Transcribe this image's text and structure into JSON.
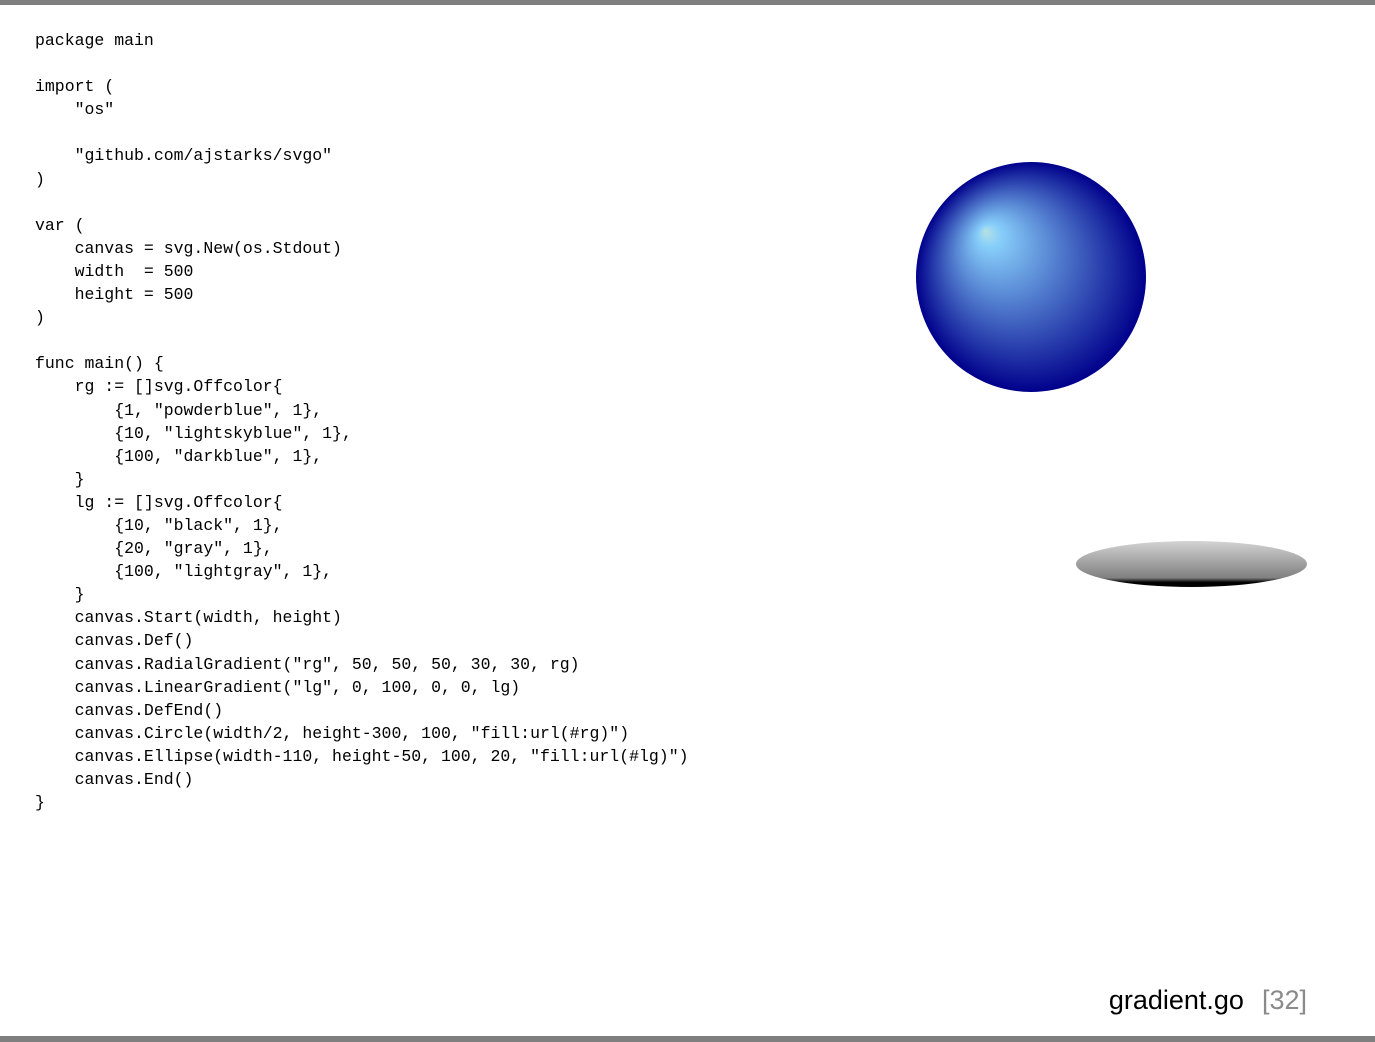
{
  "code": {
    "lines": [
      "package main",
      "",
      "import (",
      "    \"os\"",
      "",
      "    \"github.com/ajstarks/svgo\"",
      ")",
      "",
      "var (",
      "    canvas = svg.New(os.Stdout)",
      "    width  = 500",
      "    height = 500",
      ")",
      "",
      "func main() {",
      "    rg := []svg.Offcolor{",
      "        {1, \"powderblue\", 1},",
      "        {10, \"lightskyblue\", 1},",
      "        {100, \"darkblue\", 1},",
      "    }",
      "    lg := []svg.Offcolor{",
      "        {10, \"black\", 1},",
      "        {20, \"gray\", 1},",
      "        {100, \"lightgray\", 1},",
      "    }",
      "    canvas.Start(width, height)",
      "    canvas.Def()",
      "    canvas.RadialGradient(\"rg\", 50, 50, 50, 30, 30, rg)",
      "    canvas.LinearGradient(\"lg\", 0, 100, 0, 0, lg)",
      "    canvas.DefEnd()",
      "    canvas.Circle(width/2, height-300, 100, \"fill:url(#rg)\")",
      "    canvas.Ellipse(width-110, height-50, 100, 20, \"fill:url(#lg)\")",
      "    canvas.End()",
      "}"
    ]
  },
  "footer": {
    "filename": "gradient.go",
    "page": "[32]"
  },
  "colors": {
    "frame_bar": "#7f7f7f",
    "text": "#000000",
    "page_number": "#8a8a8a",
    "radial_powderblue": "#b0e0e6",
    "radial_lightskyblue": "#87cefa",
    "radial_darkblue": "#00008b",
    "linear_black": "#000000",
    "linear_gray": "#808080",
    "linear_lightgray": "#d3d3d3"
  }
}
